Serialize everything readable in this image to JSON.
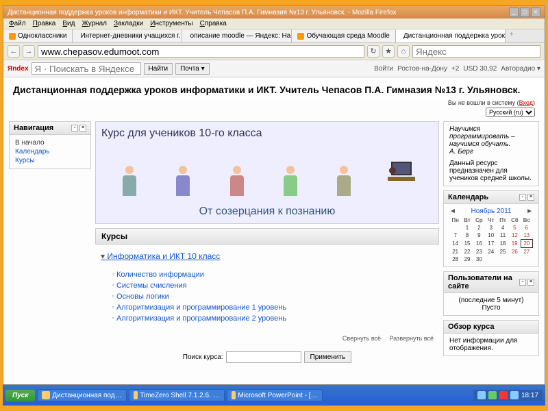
{
  "window": {
    "title": "Дистанционная поддержка уроков информатики и ИКТ. Учитель Чепасов П.А. Гимназия №13 г. Ульяновск. - Mozilla Firefox",
    "min": "_",
    "max": "□",
    "close": "×"
  },
  "menubar": [
    "Файл",
    "Правка",
    "Вид",
    "Журнал",
    "Закладки",
    "Инструменты",
    "Справка"
  ],
  "tabs": {
    "items": [
      {
        "label": "Одноклассники"
      },
      {
        "label": "Интернет-дневники учащихся г. Уль…"
      },
      {
        "label": "описание moodle — Яндекс: Нашлось …"
      },
      {
        "label": "Обучающая среда Moodle"
      },
      {
        "label": "Дистанционная поддержка уроков ин…"
      }
    ],
    "newtab": "+"
  },
  "addr": {
    "back": "←",
    "fwd": "→",
    "url": "www.chepasov.edumoot.com",
    "reload": "↻",
    "home": "⌂",
    "engine_placeholder": "Яндекс"
  },
  "ysearch": {
    "logo": "Яndex",
    "placeholder": "Я · Поискать в Яндексе",
    "find": "Найти",
    "mail": "Почта ▾",
    "right": [
      "Войти",
      "Ростов-на-Дону",
      "+2",
      "USD 30,92",
      "Авторадио ▾"
    ]
  },
  "page": {
    "title": "Дистанционная поддержка уроков информатики и ИКТ. Учитель Чепасов П.А. Гимназия №13 г. Ульяновск.",
    "login_prefix": "Вы не вошли в систему (",
    "login_link": "Вход",
    "login_suffix": ")",
    "lang": "Русский (ru)"
  },
  "nav": {
    "title": "Навигация",
    "items": [
      {
        "label": "В начало",
        "link": false
      },
      {
        "label": "Календарь",
        "link": true
      },
      {
        "label": "Курсы",
        "link": true
      }
    ]
  },
  "banner": {
    "top": "Курс для учеников 10-го класса",
    "bottom": "От созерцания к познанию"
  },
  "courses": {
    "title": "Курсы",
    "category": "Информатика и ИКТ 10 класс",
    "items": [
      "Количество информации",
      "Системы счисления",
      "Основы логики",
      "Алгоритмизация и программирование 1 уровень",
      "Алгоритмизация и программирование 2 уровень"
    ],
    "search_label": "Поиск курса:",
    "apply": "Применить",
    "collapse": "Свернуть всё",
    "expand": "Развернуть всё"
  },
  "info": {
    "quote": "Научимся программировать – научимся обучать.",
    "author": "А. Берг",
    "desc": "Данный ресурс предназначен для учеников средней школы."
  },
  "calendar": {
    "title": "Календарь",
    "month": "Ноябрь 2011",
    "prev": "◄",
    "next": "►",
    "dow": [
      "Пн",
      "Вт",
      "Ср",
      "Чт",
      "Пт",
      "Сб",
      "Вс"
    ],
    "weeks": [
      [
        "",
        "1",
        "2",
        "3",
        "4",
        "5",
        "6"
      ],
      [
        "7",
        "8",
        "9",
        "10",
        "11",
        "12",
        "13"
      ],
      [
        "14",
        "15",
        "16",
        "17",
        "18",
        "19",
        "20"
      ],
      [
        "21",
        "22",
        "23",
        "24",
        "25",
        "26",
        "27"
      ],
      [
        "28",
        "29",
        "30",
        "",
        "",
        "",
        ""
      ]
    ],
    "today": "20"
  },
  "online": {
    "title": "Пользователи на сайте",
    "sub": "(последние 5 минут)",
    "val": "Пусто"
  },
  "overview": {
    "title": "Обзор курса",
    "val": "Нет информации для отображения."
  },
  "taskbar": {
    "start": "Пуск",
    "items": [
      "Дистанционная под…",
      "TimeZero Shell 7.1.2.6. …",
      "Microsoft PowerPoint - […"
    ],
    "clock": "18:17"
  }
}
